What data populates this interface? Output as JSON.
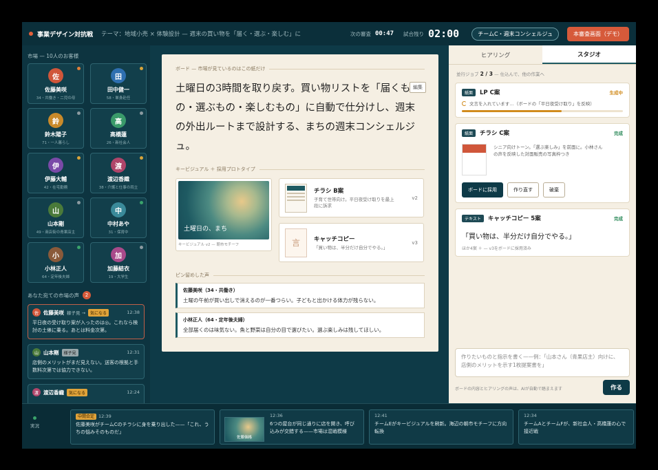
{
  "topbar": {
    "title": "事業デザイン対抗戦",
    "theme": "テーマ：地域小売 × 体験設計 — 週末の買い物を「届く・選ぶ・楽しむ」に",
    "next_review_label": "次の審査",
    "next_review_time": "00:47",
    "remaining_label": "試合残り",
    "remaining_time": "02:00",
    "team": "チームC・週末コンシェルジュ",
    "demo_button": "本審査画面（デモ）"
  },
  "sidebar": {
    "market_label": "市場 — 10人のお客様",
    "customers": [
      {
        "initial": "佐",
        "name": "佐藤美咲",
        "meta": "34・共働き・二児の母",
        "color": "#d0563a",
        "status": "#e0803a"
      },
      {
        "initial": "田",
        "name": "田中健一",
        "meta": "58・単身赴任",
        "color": "#2f6fb0",
        "status": "#d9a43a"
      },
      {
        "initial": "鈴",
        "name": "鈴木陽子",
        "meta": "71・一人暮らし",
        "color": "#c98a2a",
        "status": "#8b9aa0"
      },
      {
        "initial": "高",
        "name": "高橋蓮",
        "meta": "26・新社会人",
        "color": "#3a9a6a",
        "status": "#8b9aa0"
      },
      {
        "initial": "伊",
        "name": "伊藤大輔",
        "meta": "42・在宅勤務",
        "color": "#7a4aa8",
        "status": "#d9a43a"
      },
      {
        "initial": "渡",
        "name": "渡辺香織",
        "meta": "38・介護と仕事の両立",
        "color": "#b0456a",
        "status": "#d9a43a"
      },
      {
        "initial": "山",
        "name": "山本剛",
        "meta": "49・商店街の青果店主",
        "color": "#4a7a3a",
        "status": "#8b9aa0"
      },
      {
        "initial": "中",
        "name": "中村あや",
        "meta": "31・保育中",
        "color": "#3a8a9a",
        "status": "#3aa36b"
      },
      {
        "initial": "小",
        "name": "小林正人",
        "meta": "64・定年後夫婦",
        "color": "#8a5a3a",
        "status": "#3aa36b"
      },
      {
        "initial": "加",
        "name": "加藤結衣",
        "meta": "19・大学生",
        "color": "#a84a8a",
        "status": "#8b9aa0"
      }
    ],
    "voices_label": "あなた宛ての市場の声",
    "voices_count": "2",
    "voices": [
      {
        "initial": "佐",
        "name": "佐藤美咲",
        "arrow": "稼子見 →",
        "tag": "気になる",
        "time": "12:38",
        "text": "平日夜の受け取り案が入ったのは◎。これなら検討の土俵に乗る。あとは料金次第。",
        "color": "#d0563a"
      },
      {
        "initial": "山",
        "name": "山本剛",
        "arrow": "",
        "tag": "様子見",
        "time": "12:31",
        "text": "店側のメリットがまだ見えない。送客の根拠と手数料次第では協力できない。",
        "color": "#4a7a3a"
      },
      {
        "initial": "渡",
        "name": "渡辺香織",
        "arrow": "",
        "tag": "気になる",
        "time": "12:24",
        "text": "",
        "color": "#b0456a"
      }
    ]
  },
  "board": {
    "label": "ボード — 市場が見ているのはこの紙だけ",
    "edit": "編集",
    "headline": "土曜日の3時間を取り戻す。買い物リストを「届くもの・選ぶもの・楽しむもの」に自動で仕分けし、週末の外出ルートまで設計する、まちの週末コンシェルジュ。",
    "visual_label": "キービジュアル ＋ 採用プロトタイプ",
    "kv_title": "土曜日の、まち",
    "kv_caption": "キービジュアル v2 — 朝市モチーフ",
    "prototypes": [
      {
        "title": "チラシ B案",
        "desc": "子育て世帯向け。平日夜受け取りを最上段に訴求",
        "ver": "v2"
      },
      {
        "title": "キャッチコピー",
        "desc": "「買い物は、半分だけ自分でやる。」",
        "ver": "v3",
        "glyph": "言"
      }
    ],
    "pinned_label": "ピン留めした声",
    "pins": [
      {
        "name": "佐藤美咲（34・共働き）",
        "text": "土曜の午前が買い出しで消えるのが一番つらい。子どもと出かける体力が残らない。"
      },
      {
        "name": "小林正人（64・定年後夫婦）",
        "text": "全部届くのは味気ない。魚と野菜は自分の目で選びたい。選ぶ楽しみは残してほしい。"
      }
    ]
  },
  "rpanel": {
    "tabs": [
      "ヒアリング",
      "スタジオ"
    ],
    "jobs_label": "並行ジョブ",
    "jobs_count": "2 / 3",
    "jobs_note": "— 仕込んで、他の作業へ",
    "jobs": [
      {
        "tag": "紙面",
        "title": "LP C案",
        "status": "生成中",
        "progress_text": "文言を入れています…（ボードの「平日夜受け取り」を反映）",
        "progress": 0.62
      },
      {
        "tag": "紙面",
        "title": "チラシ C案",
        "status": "完成",
        "desc": "シニア向けトーン。「選ぶ楽しみ」を前面に。小林さんの声を反映した対面販売の写真枠つき",
        "buttons": [
          "ボードに採用",
          "作り直す",
          "破棄"
        ]
      },
      {
        "tag": "テキスト",
        "title": "キャッチコピー 5案",
        "status": "完成",
        "quote": "「買い物は、半分だけ自分でやる。」",
        "note": "ほか4案 ＋ — v3をボードに採用済み"
      }
    ],
    "input_placeholder": "作りたいものと指示を書く——例：「山本さん（青果店主）向けに、店側のメリットを示す1枚提案書を」",
    "footer_note": "ボードの内容とヒアリングの声は、AIが自動で踏まえます",
    "make_button": "作る"
  },
  "bottom": {
    "live_label": "実況",
    "feed": [
      {
        "tag": "中間合定",
        "time": "12:39",
        "text": "佐藤美咲がチームCのチラシに身を乗り出した——「これ、うちの悩みそのものだ」"
      },
      {
        "time": "12:36",
        "text": "6つの屋台が同じ通りに店を開き、呼び込みが交錯する——市場は混戦模様",
        "img_label": "佐藤価格"
      },
      {
        "time": "12:41",
        "text": "チームEがキービジュアルを刷新。海辺の朝市モチーフに方向転換"
      },
      {
        "time": "12:34",
        "text": "チームAとチームFが、新社会人・高橋蓮の心で接近戦"
      }
    ]
  }
}
